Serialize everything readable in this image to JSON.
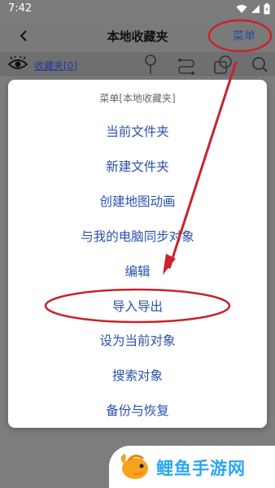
{
  "status_bar": {
    "time": "7:42"
  },
  "header": {
    "title": "本地收藏夹",
    "menu_label": "菜单"
  },
  "toolbar": {
    "favorites_link": "收藏夹[0]"
  },
  "dialog": {
    "title": "菜单[本地收藏夹]",
    "items": [
      "当前文件夹",
      "新建文件夹",
      "创建地图动画",
      "与我的电脑同步对象",
      "编辑",
      "导入导出",
      "设为当前对象",
      "搜索对象",
      "备份与恢复"
    ]
  },
  "watermark": {
    "text": "鲤鱼手游网"
  },
  "colors": {
    "accent": "#2a4fae",
    "annotation": "#c8232c",
    "watermark": "#2aa6ee"
  }
}
